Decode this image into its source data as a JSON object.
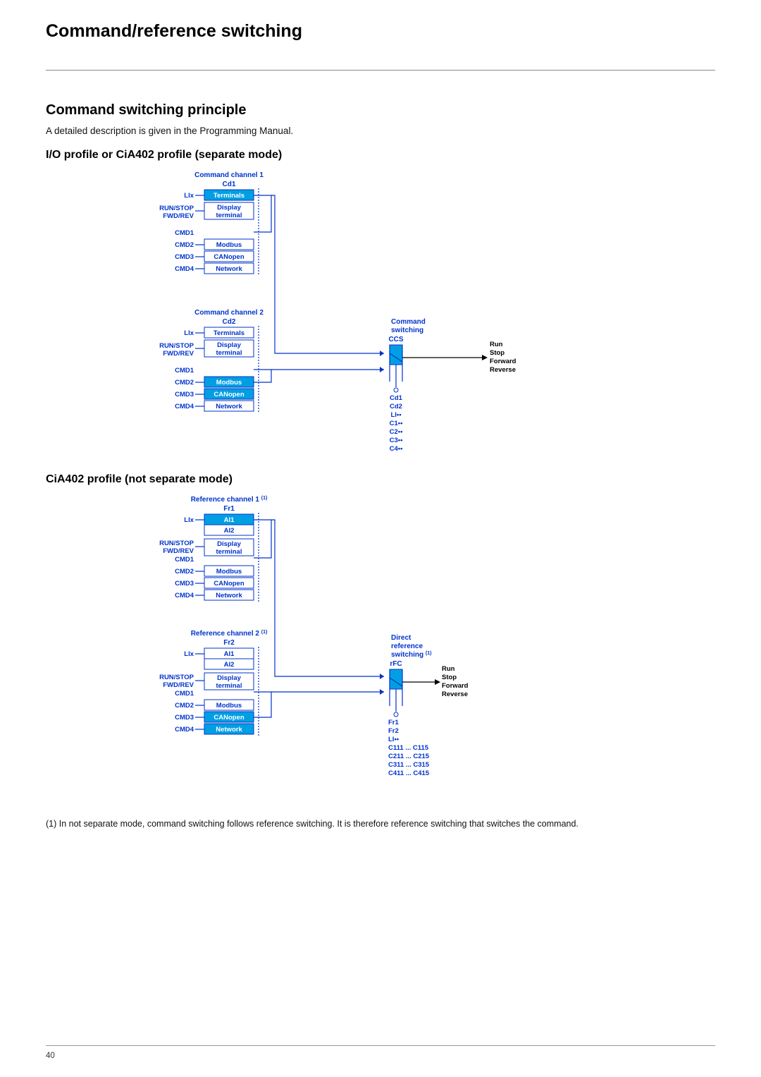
{
  "page": {
    "title": "Command/reference switching",
    "number": "40"
  },
  "section1": {
    "heading": "Command switching principle",
    "body": "A detailed description is given in the Programming Manual."
  },
  "sub1": {
    "heading": "I/O profile or CiA402 profile (separate mode)"
  },
  "diagramA": {
    "ch1_title": "Command channel 1",
    "ch1_param": "Cd1",
    "ch2_title": "Command channel 2",
    "ch2_param": "Cd2",
    "sw_title_l1": "Command",
    "sw_title_l2": "switching",
    "sw_param": "CCS",
    "inputs": {
      "lix": "LIx",
      "runstop": "RUN/STOP",
      "fwdrev": "FWD/REV",
      "cmd1": "CMD1",
      "cmd2": "CMD2",
      "cmd3": "CMD3",
      "cmd4": "CMD4"
    },
    "rows": {
      "terminals": "Terminals",
      "display_l1": "Display",
      "display_l2": "terminal",
      "modbus": "Modbus",
      "canopen": "CANopen",
      "network": "Network"
    },
    "sw_list": {
      "a": "Cd1",
      "b": "Cd2",
      "c": "LI••",
      "d": "C1••",
      "e": "C2••",
      "f": "C3••",
      "g": "C4••"
    },
    "outputs": {
      "run": "Run",
      "stop": "Stop",
      "fwd": "Forward",
      "rev": "Reverse"
    }
  },
  "sub2": {
    "heading": "CiA402 profile (not separate mode)"
  },
  "diagramB": {
    "ch1_title": "Reference channel 1 ",
    "ch1_sup": "(1)",
    "ch1_param": "Fr1",
    "ch2_title": "Reference channel 2 ",
    "ch2_sup": "(1)",
    "ch2_param": "Fr2",
    "sw_title_l1": "Direct",
    "sw_title_l2": "reference",
    "sw_title_l3": "switching ",
    "sw_sup": "(1)",
    "sw_param": "rFC",
    "inputs": {
      "lix": "LIx",
      "runstop": "RUN/STOP",
      "fwdrev": "FWD/REV",
      "cmd1": "CMD1",
      "cmd2": "CMD2",
      "cmd3": "CMD3",
      "cmd4": "CMD4"
    },
    "rows": {
      "ai1": "AI1",
      "ai2": "AI2",
      "display_l1": "Display",
      "display_l2": "terminal",
      "modbus": "Modbus",
      "canopen": "CANopen",
      "network": "Network"
    },
    "sw_list": {
      "a": "Fr1",
      "b": "Fr2",
      "c": "LI••",
      "d": "C111 ... C115",
      "e": "C211 ... C215",
      "f": "C311 ... C315",
      "g": "C411 ... C415"
    },
    "outputs": {
      "run": "Run",
      "stop": "Stop",
      "fwd": "Forward",
      "rev": "Reverse"
    }
  },
  "footnote": "(1) In not separate mode, command switching follows reference switching. It is therefore reference switching that switches the command."
}
